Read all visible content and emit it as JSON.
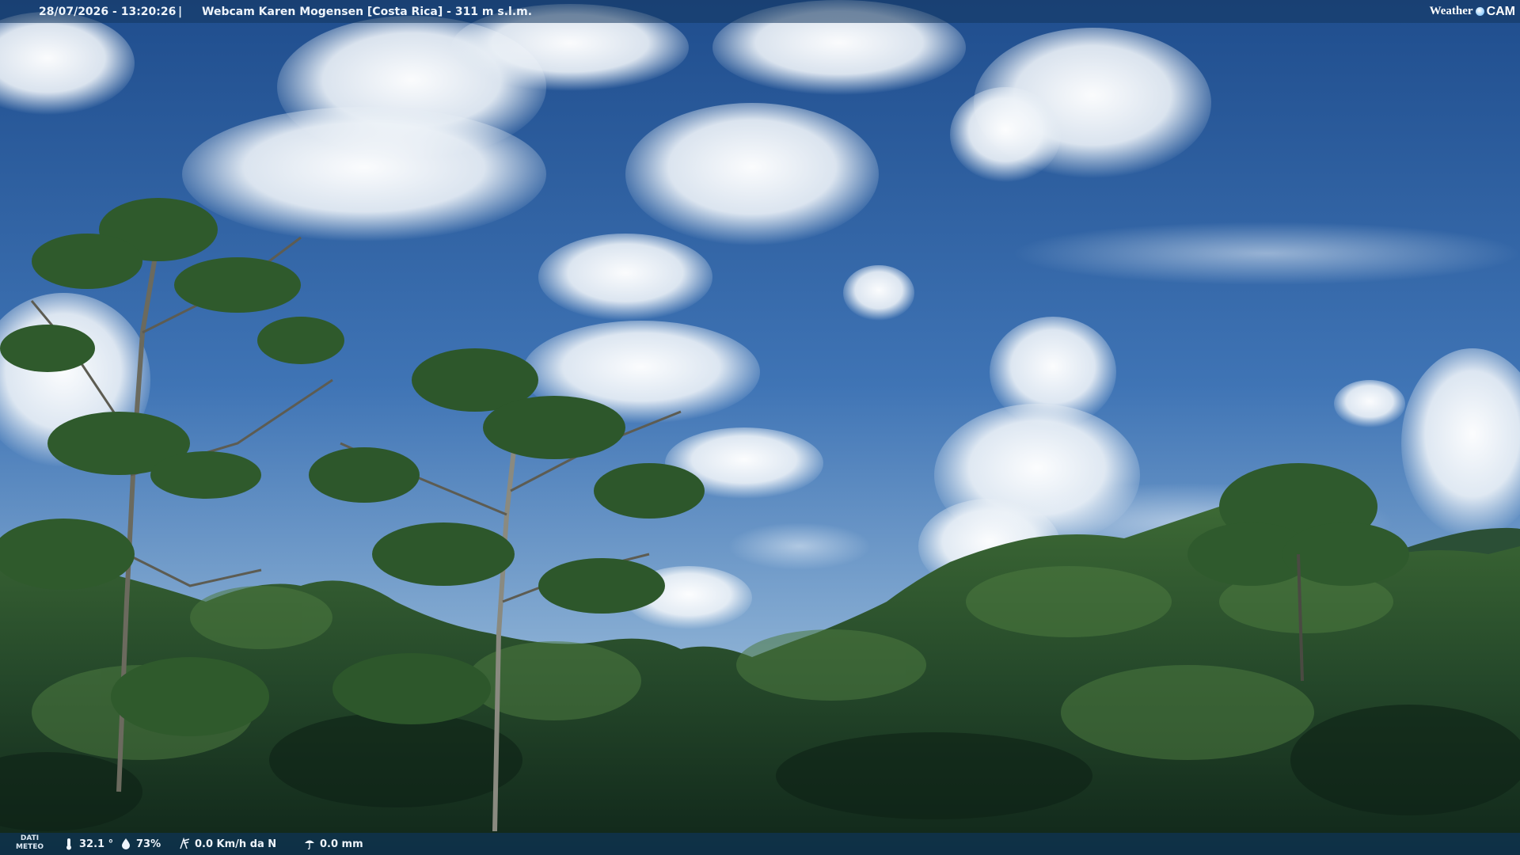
{
  "overlay_top": {
    "timestamp": "28/07/2026 - 13:20:26",
    "separator": "|",
    "camera_title": "Webcam Karen Mogensen [Costa Rica] - 311 m s.l.m.",
    "brand_part1": "Weather",
    "brand_part2": "CAM"
  },
  "overlay_bottom": {
    "label_line1": "DATI",
    "label_line2": "METEO",
    "temperature": "32.1 °",
    "humidity": "73%",
    "wind": "0.0 Km/h da N",
    "rain": "0.0 mm"
  },
  "icons": [
    "thermometer-icon",
    "humidity-icon",
    "wind-icon",
    "rain-icon"
  ],
  "colors": {
    "sky_top": "#1f4e8f",
    "sky_horizon": "#9fbdd9",
    "forest_dark": "#14301a",
    "forest_light": "#3e6a35",
    "overlay_bar": "#14375f"
  }
}
